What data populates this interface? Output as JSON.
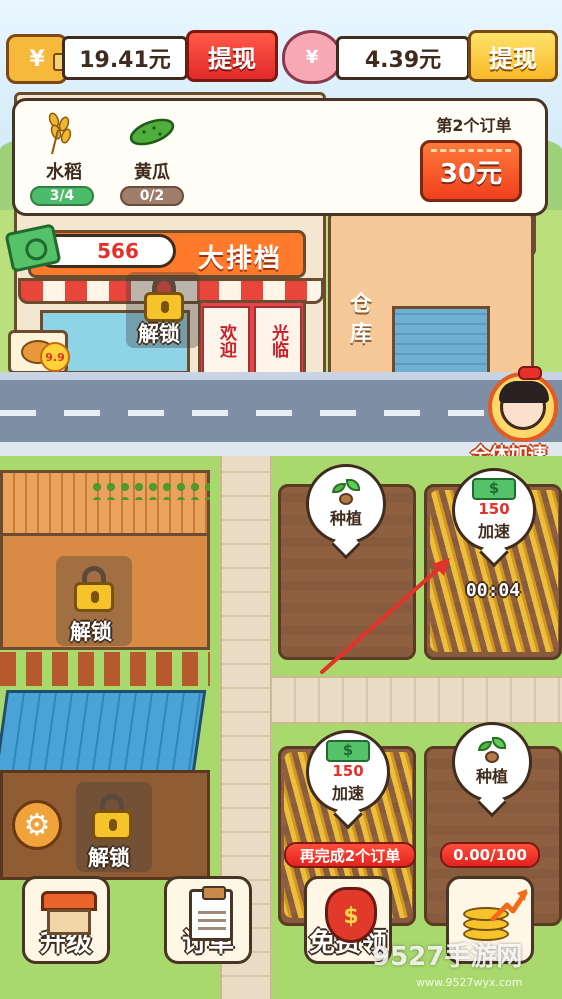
{
  "currency": {
    "cash_amount": "19.41元",
    "cash_withdraw_label": "提现",
    "piggy_amount": "4.39元",
    "piggy_withdraw_label": "提现",
    "wallet_glyph": "¥",
    "piggy_glyph": "¥"
  },
  "order": {
    "crops": [
      {
        "name": "水稻",
        "progress": "3/4",
        "icon": "wheat-icon"
      },
      {
        "name": "黄瓜",
        "progress": "0/2",
        "icon": "cucumber-icon"
      }
    ],
    "order_number_label": "第2个订单",
    "reward": "30元"
  },
  "money_counter": "566",
  "restaurant": {
    "sign": "大排档",
    "door_left": "欢迎",
    "door_right": "光临",
    "lock_label": "解锁",
    "food_badge": "9.9"
  },
  "warehouse": {
    "label": "仓库"
  },
  "speed_all_label": "全体加速",
  "plots": [
    {
      "action": "种植"
    },
    {
      "reward": "150",
      "action": "加速",
      "timer": "00:04"
    },
    {
      "reward": "150",
      "action": "加速"
    },
    {
      "action": "种植"
    }
  ],
  "locked_areas": [
    {
      "label": "解锁"
    },
    {
      "label": "解锁"
    }
  ],
  "bottom_bar": {
    "upgrade_label": "升级",
    "orders_label": "订单",
    "free_label": "免费领",
    "free_tag": "再完成2个订单",
    "coin_progress": "0.00/100"
  },
  "watermark": {
    "main": "9527手游网",
    "sub": "www.9527wyx.com"
  },
  "colors": {
    "accent_red": "#e8302a",
    "accent_yellow": "#f7b928",
    "grass": "#a9d86d"
  }
}
